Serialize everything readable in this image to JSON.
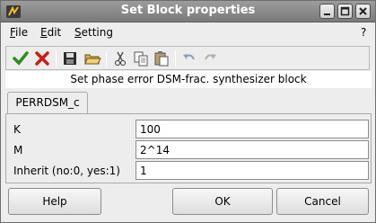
{
  "window": {
    "title": "Set Block properties",
    "icon": "scilab-icon"
  },
  "window_controls": [
    "minimize-icon",
    "maximize-icon",
    "close-icon"
  ],
  "menu": {
    "file": "File",
    "edit": "Edit",
    "setting": "Setting",
    "help": "?"
  },
  "toolbar": {
    "icons": [
      "ok-check-icon",
      "cancel-x-icon",
      "save-icon",
      "open-folder-icon",
      "cut-icon",
      "copy-icon",
      "paste-icon",
      "undo-icon",
      "redo-icon"
    ]
  },
  "description": "Set phase error DSM-frac. synthesizer block",
  "tabs": [
    {
      "label": "PERRDSM_c"
    }
  ],
  "params": [
    {
      "label": "K",
      "value": "100"
    },
    {
      "label": "M",
      "value": "2^14"
    },
    {
      "label": "Inherit (no:0, yes:1)",
      "value": "1"
    }
  ],
  "buttons": {
    "help": "Help",
    "ok": "OK",
    "cancel": "Cancel"
  },
  "colors": {
    "titlebar": "#8a8a8a",
    "check_green": "#2e8b1e",
    "cross_red": "#cc1b12"
  }
}
